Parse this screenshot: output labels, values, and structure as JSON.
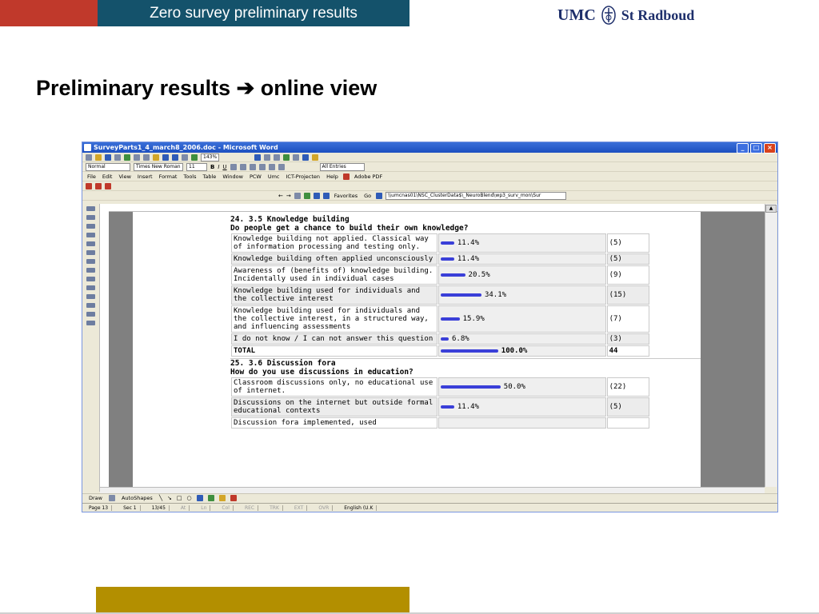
{
  "slide": {
    "header_title": "Zero survey preliminary results",
    "logo_umc": "UMC",
    "logo_radboud": "St Radboud",
    "heading": "Preliminary results ➔ online view"
  },
  "window": {
    "title": "SurveyParts1_4_march8_2006.doc - Microsoft Word",
    "zoom": "143%",
    "style_box": "Normal",
    "font_box": "Times New Roman",
    "size_box": "11",
    "entries_box": "All Entries",
    "menus": [
      "File",
      "Edit",
      "View",
      "Insert",
      "Format",
      "Tools",
      "Table",
      "Window",
      "PCW",
      "Umc",
      "ICT-Projecten",
      "Help"
    ],
    "adobe_label": "Adobe PDF",
    "favorites_label": "Favorites",
    "go_label": "Go",
    "address": "\\\\umcnas01\\NSC_ClusterData$\\_NeuroBlend\\wp3_surv_mon\\Sur"
  },
  "survey": {
    "q24_title": "24. 3.5 Knowledge building",
    "q24_subtitle": "Do people get a chance to build their own knowledge?",
    "q24_rows": [
      {
        "answer": "Knowledge building not applied. Classical way of information processing and testing only.",
        "pct": "11.4%",
        "value": 11.4,
        "count": "(5)"
      },
      {
        "answer": "Knowledge building often applied unconsciously",
        "pct": "11.4%",
        "value": 11.4,
        "count": "(5)"
      },
      {
        "answer": "Awareness of (benefits of) knowledge building. Incidentally used in individual cases",
        "pct": "20.5%",
        "value": 20.5,
        "count": "(9)"
      },
      {
        "answer": "Knowledge building used for individuals and the collective interest",
        "pct": "34.1%",
        "value": 34.1,
        "count": "(15)"
      },
      {
        "answer": "Knowledge building used for individuals and the collective interest, in a structured way, and influencing assessments",
        "pct": "15.9%",
        "value": 15.9,
        "count": "(7)"
      },
      {
        "answer": "I do not know / I can not answer this question",
        "pct": "6.8%",
        "value": 6.8,
        "count": "(3)"
      }
    ],
    "q24_total": {
      "label": "TOTAL",
      "pct": "100.0%",
      "value": 100,
      "count": "44"
    },
    "q25_title": "25. 3.6 Discussion fora",
    "q25_subtitle": "How do you use discussions in education?",
    "q25_rows": [
      {
        "answer": "Classroom discussions only, no educational use of internet.",
        "pct": "50.0%",
        "value": 50.0,
        "count": "(22)"
      },
      {
        "answer": "Discussions on the internet but outside formal educational contexts",
        "pct": "11.4%",
        "value": 11.4,
        "count": "(5)"
      },
      {
        "answer": "Discussion fora implemented, used",
        "pct": "",
        "value": null,
        "count": ""
      }
    ]
  },
  "drawbar": {
    "draw_label": "Draw",
    "autoshapes_label": "AutoShapes"
  },
  "status": {
    "page": "Page 13",
    "sec": "Sec 1",
    "pos": "13/45",
    "at": "At",
    "ln": "Ln",
    "col": "Col",
    "rec": "REC",
    "trk": "TRK",
    "ext": "EXT",
    "ovr": "OVR",
    "language": "English (U.K"
  },
  "colors": {
    "header_red": "#c0392b",
    "header_blue": "#14526b",
    "footer_gold": "#b38f00",
    "bar_blue": "#3a3fd8"
  }
}
